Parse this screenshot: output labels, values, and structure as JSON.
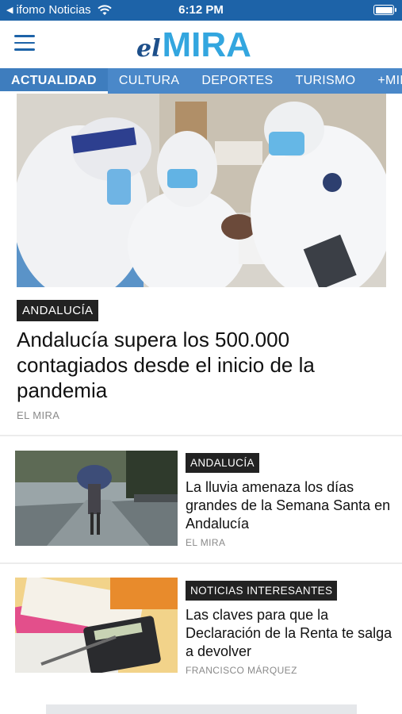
{
  "status_bar": {
    "back_app": "ifomo Noticias",
    "time": "6:12 PM"
  },
  "header": {
    "logo_el": "el",
    "logo_mira": "MIRA"
  },
  "nav": {
    "categories": [
      "ACTUALIDAD",
      "CULTURA",
      "DEPORTES",
      "TURISMO",
      "+MIRA"
    ],
    "active_index": 0
  },
  "featured": {
    "category": "ANDALUCÍA",
    "title": "Andalucía supera los 500.000 contagiados desde el inicio de la pandemia",
    "source": "EL MIRA"
  },
  "articles": [
    {
      "category": "ANDALUCÍA",
      "title": "La lluvia amenaza los días grandes de la Semana Santa en Andalucía",
      "source": "EL MIRA"
    },
    {
      "category": "NOTICIAS INTERESANTES",
      "title": "Las claves para que la Declaración de la Renta te salga a devolver",
      "source": "FRANCISCO MÁRQUEZ"
    }
  ],
  "colors": {
    "status_bar": "#1d63a8",
    "nav_bar": "#4a88c9",
    "logo_blue": "#33a6df",
    "logo_dark": "#1d4f8a",
    "badge_bg": "#222222"
  }
}
